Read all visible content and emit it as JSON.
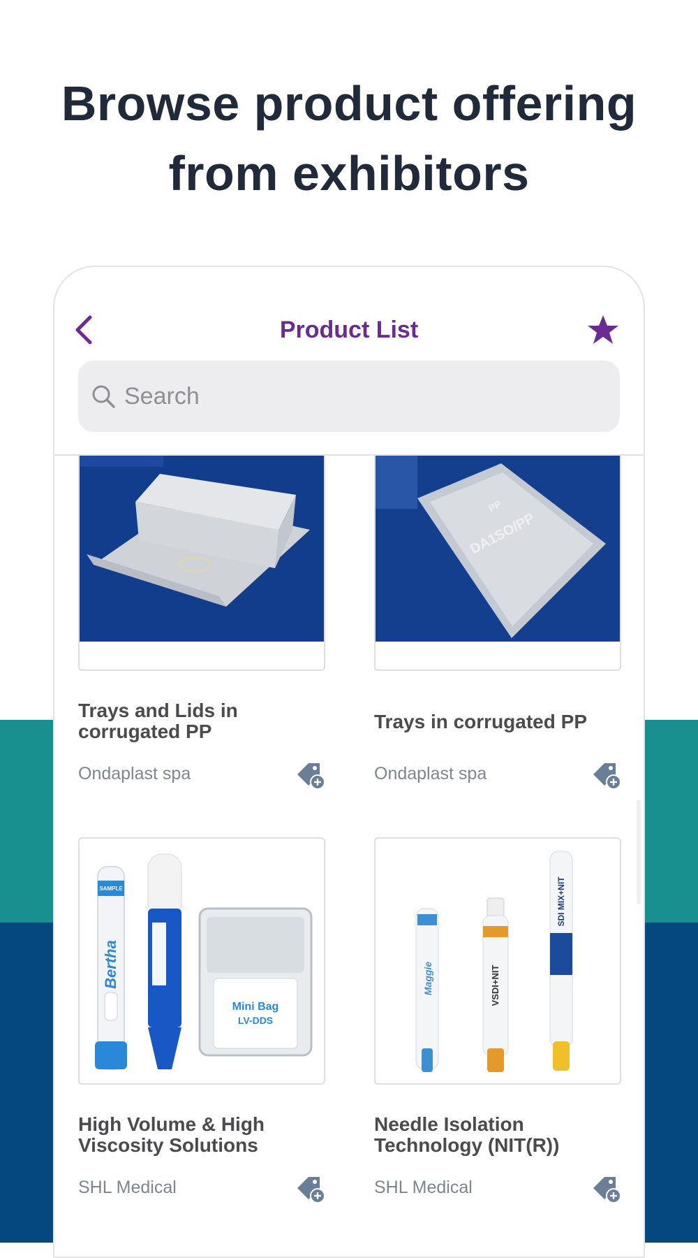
{
  "headline": {
    "line1": "Browse product offering",
    "line2": "from exhibitors"
  },
  "nav": {
    "title": "Product List",
    "back_icon": "chevron-left-icon",
    "favorite_icon": "star-icon"
  },
  "search": {
    "placeholder": "Search",
    "value": ""
  },
  "colors": {
    "accent": "#6a2c91",
    "headline": "#202a3b",
    "teal": "#17908f",
    "navy": "#05477f"
  },
  "products": [
    {
      "title": "Trays and Lids in corrugated PP",
      "company": "Ondaplast spa"
    },
    {
      "title": "Trays in corrugated PP",
      "company": "Ondaplast spa"
    },
    {
      "title": "High Volume & High Viscosity Solutions",
      "company": "SHL Medical"
    },
    {
      "title": "Needle Isolation Technology (NIT(R))",
      "company": "SHL Medical"
    }
  ],
  "image_texts": {
    "p2_line1": "PP",
    "p2_line2": "DA1SO/PP",
    "p3_a": "Bertha",
    "p3_b": "SAMPLE",
    "p3_c": "Mini Bag",
    "p3_d": "LV-DDS",
    "p4_a": "Maggie",
    "p4_b": "VSDI+NIT",
    "p4_c": "SDI MIX+NIT"
  }
}
